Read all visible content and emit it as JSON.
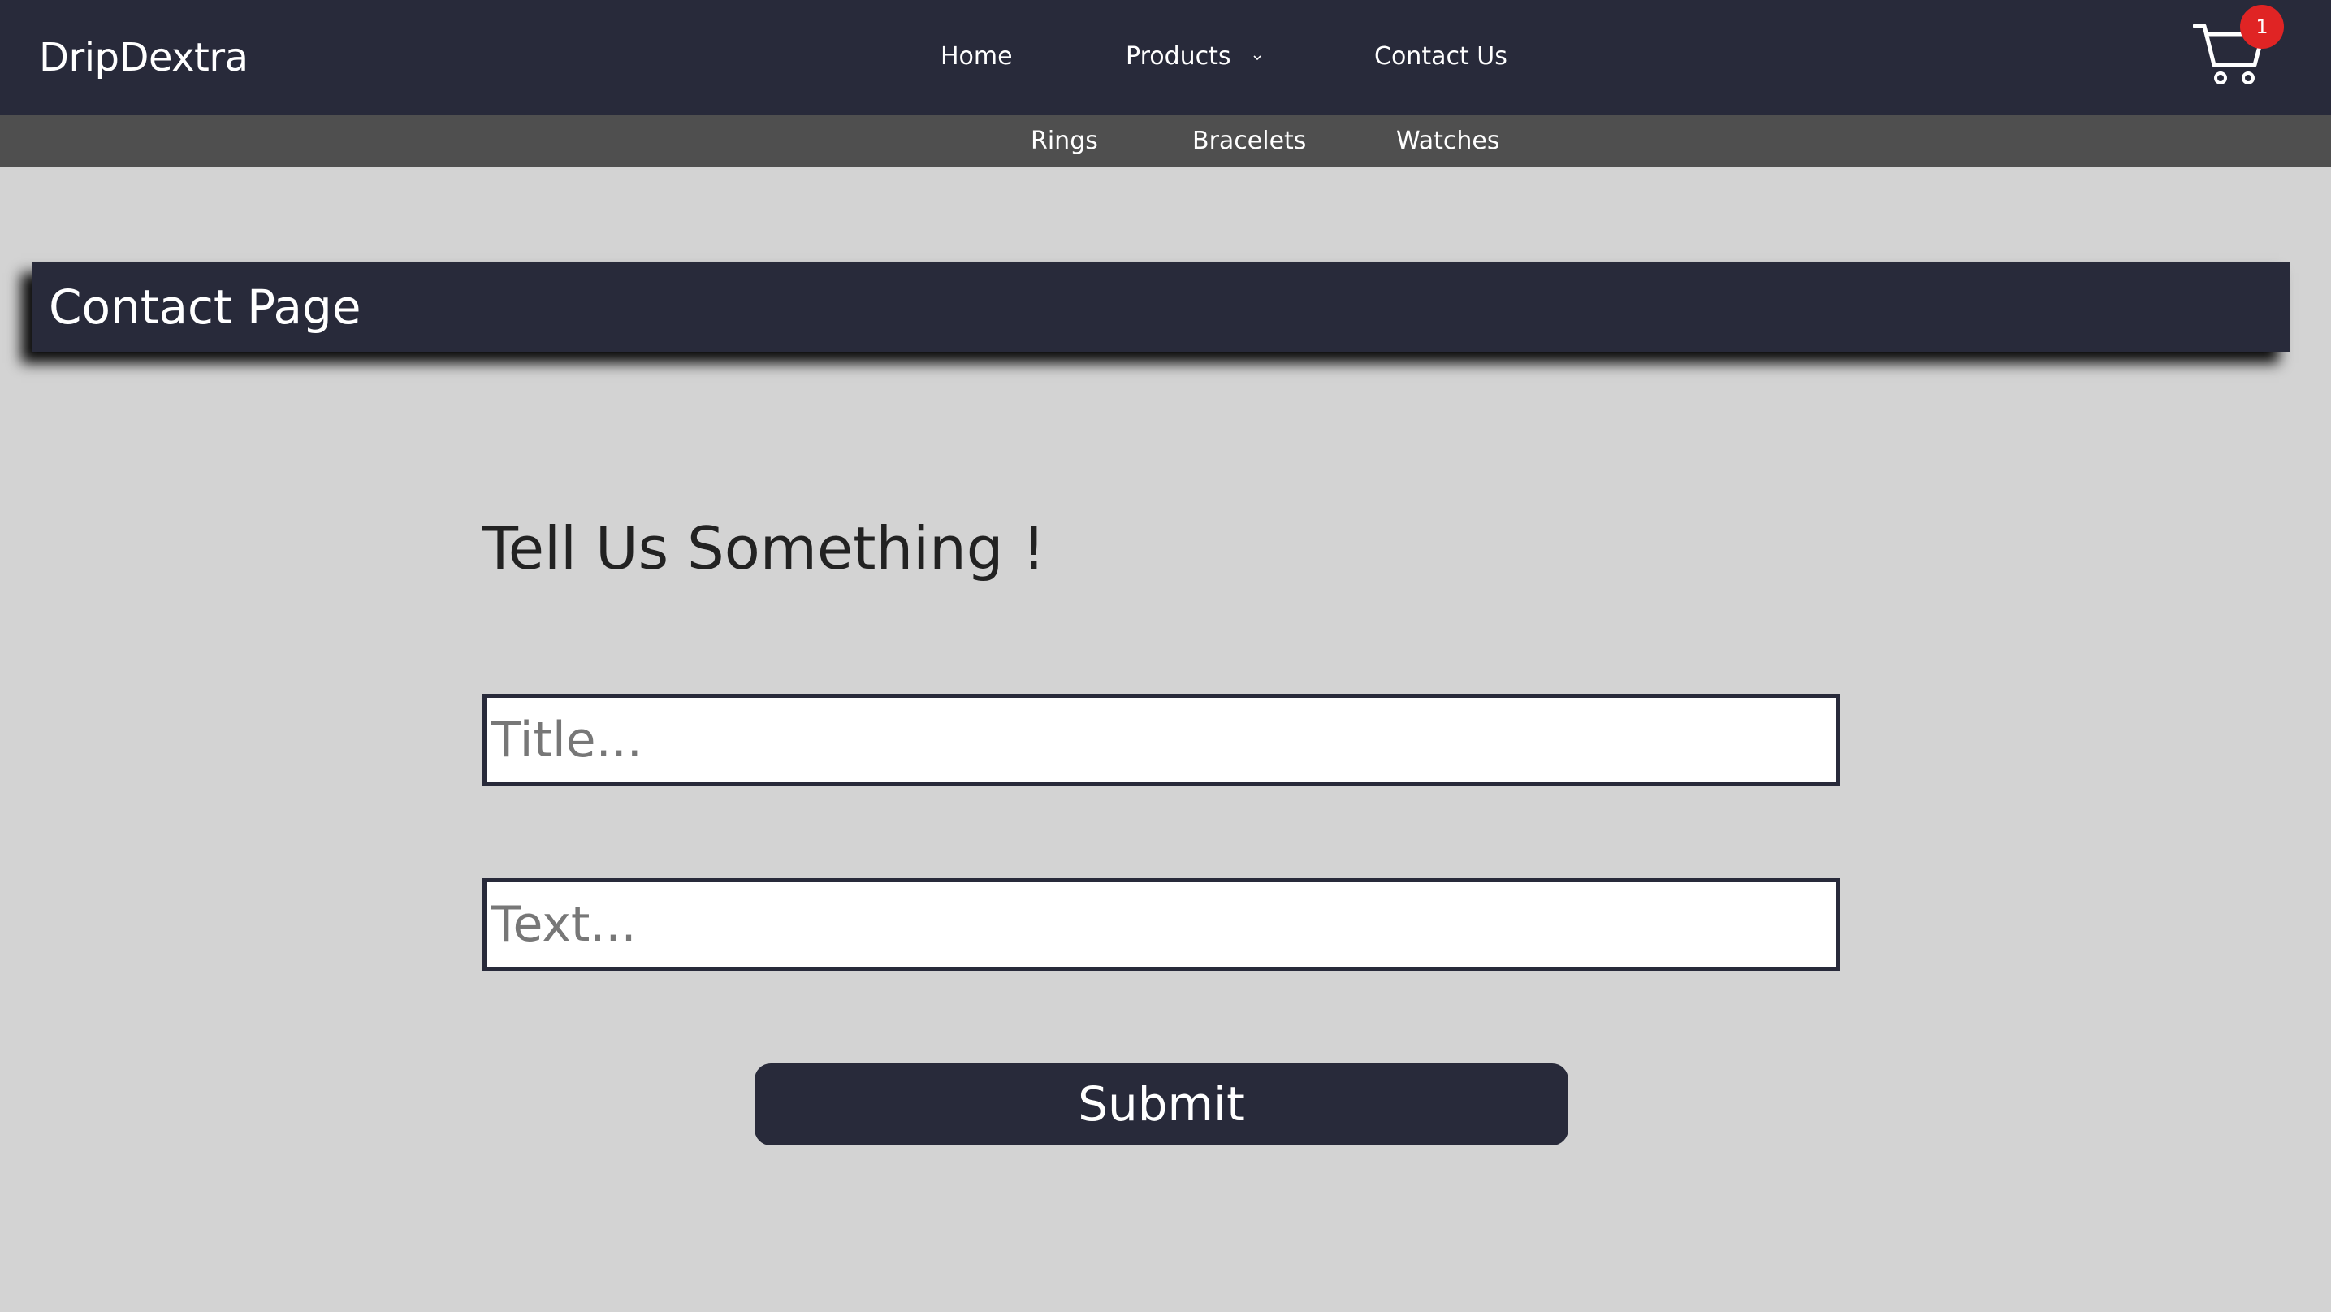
{
  "header": {
    "brand": "DripDextra",
    "nav": {
      "home": "Home",
      "products": "Products",
      "contact": "Contact Us"
    },
    "cart": {
      "badge_count": "1",
      "icon": "cart-icon"
    }
  },
  "subnav": {
    "items": [
      "Rings",
      "Bracelets",
      "Watches"
    ]
  },
  "page": {
    "title": "Contact Page"
  },
  "form": {
    "heading": "Tell Us Something !",
    "title_placeholder": "Title...",
    "text_placeholder": "Text...",
    "submit_label": "Submit"
  },
  "colors": {
    "navbar": "#282a3a",
    "subnav": "#4f4f4f",
    "background": "#d3d3d3",
    "badge": "#e02424"
  }
}
